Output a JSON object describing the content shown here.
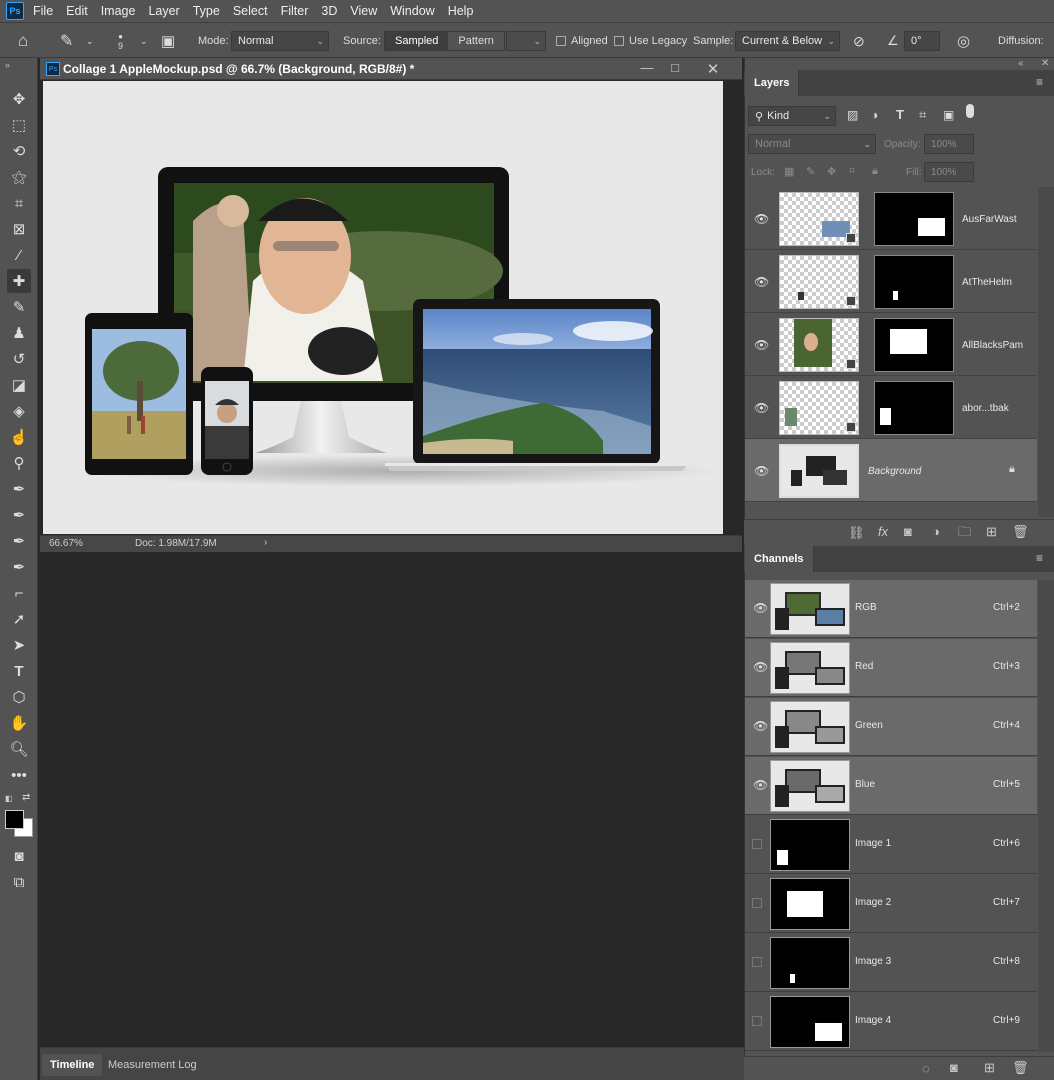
{
  "menu": [
    "File",
    "Edit",
    "Image",
    "Layer",
    "Type",
    "Select",
    "Filter",
    "3D",
    "View",
    "Window",
    "Help"
  ],
  "app_logo": "Ps",
  "options": {
    "brush_size": "9",
    "mode_label": "Mode:",
    "mode_value": "Normal",
    "source_label": "Source:",
    "source_sampled": "Sampled",
    "source_pattern": "Pattern",
    "aligned_label": "Aligned",
    "use_legacy_label": "Use Legacy",
    "sample_label": "Sample:",
    "sample_value": "Current & Below",
    "angle_value": "0°",
    "diffusion_label": "Diffusion:"
  },
  "document": {
    "title": "Collage 1 AppleMockup.psd @ 66.7% (Background, RGB/8#) *",
    "zoom": "66.67%",
    "doc_size": "Doc: 1.98M/17.9M"
  },
  "bottom_tabs": [
    "Timeline",
    "Measurement Log"
  ],
  "layers_panel": {
    "tab": "Layers",
    "kind_filter": "Kind",
    "blend_mode": "Normal",
    "opacity_label": "Opacity:",
    "opacity_value": "100%",
    "lock_label": "Lock:",
    "fill_label": "Fill:",
    "fill_value": "100%",
    "layers": [
      {
        "name": "AusFarWast"
      },
      {
        "name": "AtTheHelm"
      },
      {
        "name": "AllBlacksPam"
      },
      {
        "name": "abor...tbak"
      },
      {
        "name": "Background"
      }
    ]
  },
  "channels_panel": {
    "tab": "Channels",
    "channels": [
      {
        "name": "RGB",
        "shortcut": "Ctrl+2"
      },
      {
        "name": "Red",
        "shortcut": "Ctrl+3"
      },
      {
        "name": "Green",
        "shortcut": "Ctrl+4"
      },
      {
        "name": "Blue",
        "shortcut": "Ctrl+5"
      },
      {
        "name": "Image 1",
        "shortcut": "Ctrl+6"
      },
      {
        "name": "Image 2",
        "shortcut": "Ctrl+7"
      },
      {
        "name": "Image 3",
        "shortcut": "Ctrl+8"
      },
      {
        "name": "Image 4",
        "shortcut": "Ctrl+9"
      }
    ]
  },
  "colors": {
    "ui_dark": "#535353",
    "ui_darker": "#282828",
    "accent": "#31a8ff",
    "selected_row": "#6a6a6a"
  }
}
